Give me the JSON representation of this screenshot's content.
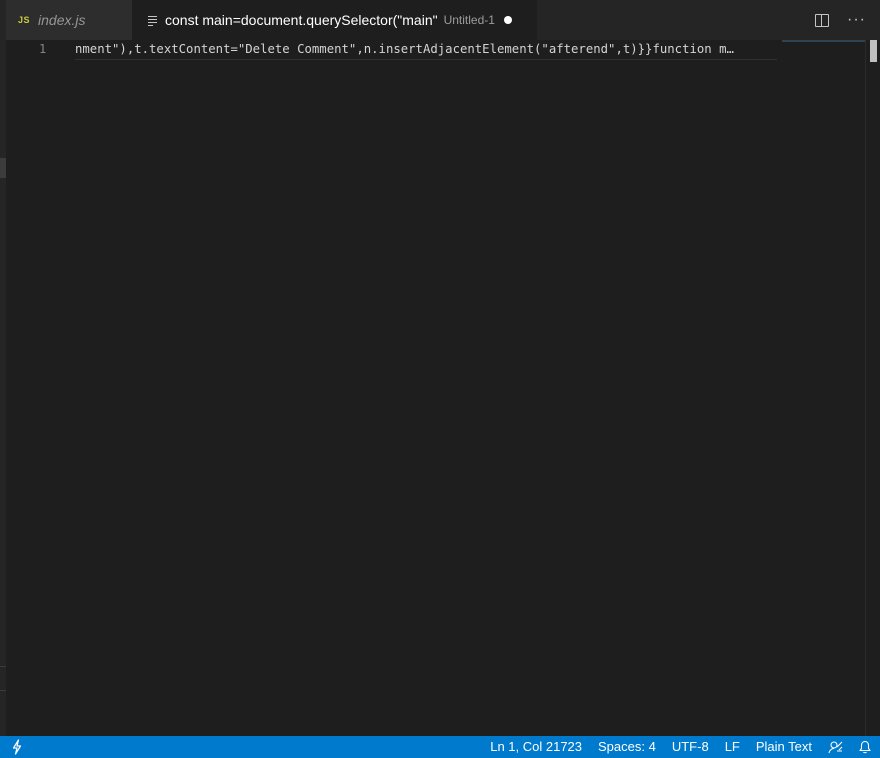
{
  "tabs": [
    {
      "label": "index.js",
      "icon": "js-file-icon",
      "icon_text": "JS",
      "active": false
    },
    {
      "label": "const main=document.querySelector(\"main\"",
      "description": "Untitled-1",
      "icon": "plain-text-file-icon",
      "dirty": true,
      "active": true
    }
  ],
  "tab_actions": {
    "split_icon": "split-editor-icon",
    "more_text": "···"
  },
  "editor": {
    "line_number": "1",
    "code": "nment\"),t.textContent=\"Delete Comment\",n.insertAdjacentElement(\"afterend\",t)}}function m…"
  },
  "statusbar": {
    "position": "Ln 1, Col 21723",
    "indent": "Spaces: 4",
    "encoding": "UTF-8",
    "eol": "LF",
    "language": "Plain Text",
    "feedback_icon": "feedback-icon",
    "bell_icon": "bell-icon",
    "color": "#007acc"
  },
  "colors": {
    "editor_bg": "#1e1e1e",
    "tabbar_bg": "#252526",
    "js_icon": "#cbcb41"
  }
}
